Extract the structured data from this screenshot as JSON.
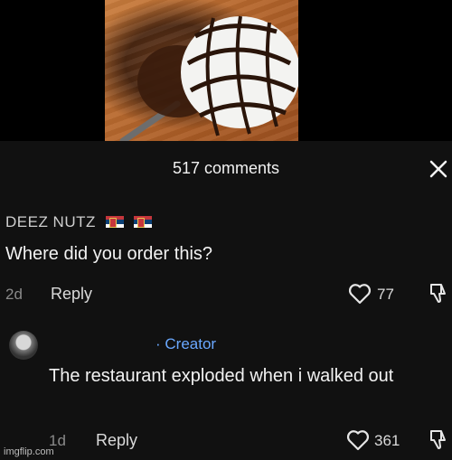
{
  "header": {
    "comments_count": "517 comments"
  },
  "comment1": {
    "username": "DEEZ NUTZ",
    "text": "Where did you order this?",
    "time": "2d",
    "reply_label": "Reply",
    "likes": "77"
  },
  "comment2": {
    "badge": "· Creator",
    "text": "The restaurant exploded when i walked out",
    "time": "1d",
    "reply_label": "Reply",
    "likes": "361"
  },
  "watermark": "imgflip.com",
  "icons": {
    "close": "close-icon",
    "like": "heart-icon",
    "dislike": "thumbs-down-icon",
    "flag": "serbia-flag-icon"
  },
  "colors": {
    "creator_accent": "#6aa8ff",
    "background": "#111111"
  }
}
